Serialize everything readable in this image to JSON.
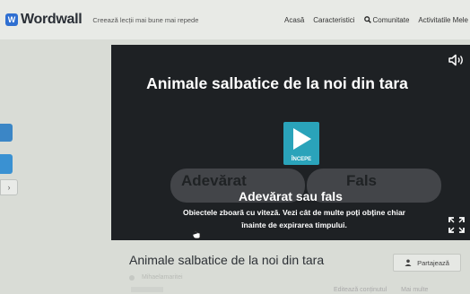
{
  "header": {
    "logo_mark": "W",
    "logo_text": "Wordwall",
    "tagline": "Creează lecții mai bune mai repede",
    "nav": {
      "home": "Acasă",
      "features": "Caracteristici",
      "community": "Comunitate",
      "my_activities": "Activitatile Mele"
    }
  },
  "activity": {
    "title": "Animale salbatice de la noi din tara",
    "start_label": "ÎNCEPE",
    "ghost_true": "Adevărat",
    "ghost_false": "Fals",
    "type": "Adevărat sau fals",
    "description": "Obiectele zboară cu viteză. Vezi cât de multe poți obține chiar înainte de expirarea timpului."
  },
  "page": {
    "title": "Animale salbatice de la noi din tara",
    "author": "Mihaelamaritei",
    "share_label": "Partajează",
    "edit_label": "Editează conținutul",
    "more_label": "Mai multe"
  },
  "colors": {
    "panel_bg": "#1e2124",
    "play_button": "#2aa3ba",
    "brand_blue": "#2f6fd1"
  }
}
